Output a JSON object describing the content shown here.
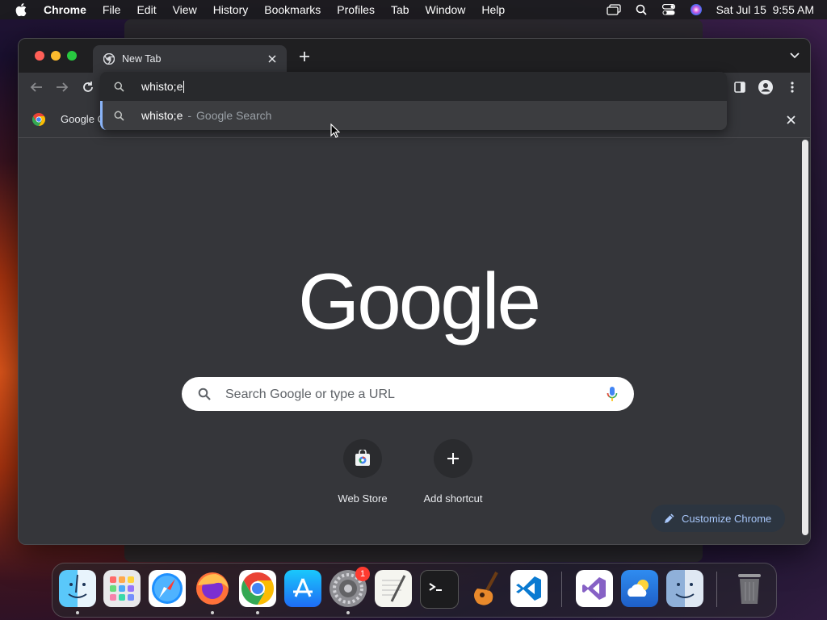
{
  "menubar": {
    "app_name": "Chrome",
    "items": [
      "File",
      "Edit",
      "View",
      "History",
      "Bookmarks",
      "Profiles",
      "Tab",
      "Window",
      "Help"
    ],
    "clock": "Sat Jul 15  9:55 AM"
  },
  "window": {
    "tab": {
      "title": "New Tab"
    }
  },
  "bookmarks_bar": {
    "label": "Google C"
  },
  "omnibox": {
    "input_value": "whisto;e",
    "suggestion": {
      "query": "whisto;e",
      "separator": "-",
      "description": "Google Search"
    }
  },
  "ntp": {
    "logo_text": "Google",
    "search_placeholder": "Search Google or type a URL",
    "shortcuts": [
      {
        "label": "Web Store"
      },
      {
        "label": "Add shortcut"
      }
    ],
    "customize_label": "Customize Chrome"
  },
  "dock": {
    "apps": [
      "Finder",
      "Launchpad",
      "Safari",
      "Firefox",
      "Chrome",
      "App Store",
      "System Settings",
      "TextEdit",
      "Terminal",
      "GarageBand",
      "VS Code",
      "Visual Studio",
      "Weather",
      "Preview",
      "Trash"
    ],
    "settings_badge": "1"
  },
  "colors": {
    "accent": "#8ab4f8",
    "chrome_bg": "#35363a",
    "customize_text": "#a8c7fa"
  }
}
